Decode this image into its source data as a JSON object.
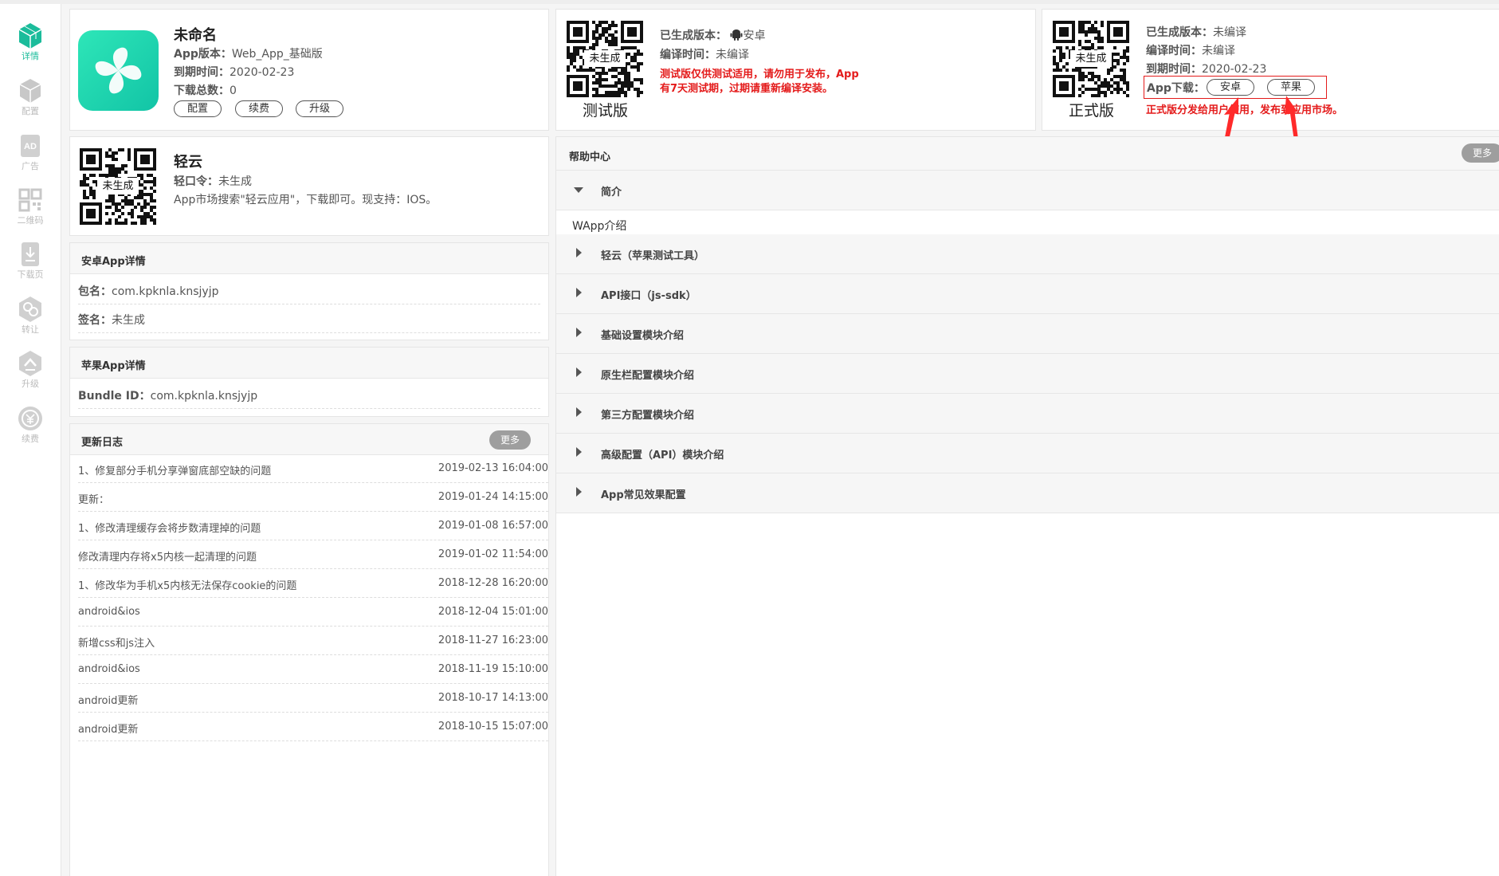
{
  "sidebar": {
    "items": [
      {
        "label": "详情",
        "icon": "cube-icon"
      },
      {
        "label": "配置",
        "icon": "box-icon"
      },
      {
        "label": "广告",
        "icon": "ad-icon"
      },
      {
        "label": "二维码",
        "icon": "qrcode-icon"
      },
      {
        "label": "下载页",
        "icon": "download-page-icon"
      },
      {
        "label": "转让",
        "icon": "transfer-icon"
      },
      {
        "label": "升级",
        "icon": "upgrade-icon"
      },
      {
        "label": "续费",
        "icon": "renew-icon"
      }
    ]
  },
  "app_card": {
    "name": "未命名",
    "version_label": "App版本：",
    "version_value": "Web_App_基础版",
    "expire_label": "到期时间：",
    "expire_value": "2020-02-23",
    "downloads_label": "下载总数：",
    "downloads_value": "0",
    "buttons": [
      "配置",
      "续费",
      "升级"
    ]
  },
  "test_build": {
    "qr_badge": "未生成",
    "caption": "测试版",
    "version_label": "已生成版本：",
    "version_value": "安卓",
    "compile_label": "编译时间：",
    "compile_value": "未编译",
    "warning_line1": "测试版仅供测试适用，请勿用于发布，App",
    "warning_line2": "有7天测试期，过期请重新编译安装。"
  },
  "release_build": {
    "qr_badge": "未生成",
    "caption": "正式版",
    "version_label": "已生成版本：",
    "version_value": "未编译",
    "compile_label": "编译时间：",
    "compile_value": "未编译",
    "expire_label": "到期时间：",
    "expire_value": "2020-02-23",
    "download_label": "App下载：",
    "download_buttons": [
      "安卓",
      "苹果"
    ],
    "note": "正式版分发给用户使用，发布到应用市场。"
  },
  "qingyun": {
    "qr_badge": "未生成",
    "title": "轻云",
    "code_label": "轻口令：",
    "code_value": "未生成",
    "desc": "App市场搜索\"轻云应用\"，下载即可。现支持：IOS。"
  },
  "android_details": {
    "title": "安卓App详情",
    "package_label": "包名：",
    "package_value": "com.kpknla.knsjyjp",
    "sign_label": "签名：",
    "sign_value": "未生成"
  },
  "ios_details": {
    "title": "苹果App详情",
    "bundle_label": "Bundle ID：",
    "bundle_value": "com.kpknla.knsjyjp"
  },
  "changelog": {
    "title": "更新日志",
    "more": "更多",
    "entries": [
      {
        "text": "1、修复部分手机分享弹窗底部空缺的问题",
        "time": "2019-02-13 16:04:00"
      },
      {
        "text": "更新：",
        "time": "2019-01-24 14:15:00"
      },
      {
        "text": "1、修改清理缓存会将步数清理掉的问题",
        "time": "2019-01-08 16:57:00"
      },
      {
        "text": "修改清理内存将x5内核一起清理的问题",
        "time": "2019-01-02 11:54:00"
      },
      {
        "text": "1、修改华为手机x5内核无法保存cookie的问题",
        "time": "2018-12-28 16:20:00"
      },
      {
        "text": "android&ios",
        "time": "2018-12-04 15:01:00"
      },
      {
        "text": "新增css和js注入",
        "time": "2018-11-27 16:23:00"
      },
      {
        "text": "android&ios",
        "time": "2018-11-19 15:10:00"
      },
      {
        "text": "android更新",
        "time": "2018-10-17 14:13:00"
      },
      {
        "text": "android更新",
        "time": "2018-10-15 15:07:00"
      }
    ]
  },
  "help_center": {
    "title": "帮助中心",
    "more": "更多",
    "expanded": {
      "label": "简介",
      "content": "WApp介绍"
    },
    "items": [
      "轻云（苹果测试工具）",
      "API接口（js-sdk）",
      "基础设置模块介绍",
      "原生栏配置模块介绍",
      "第三方配置模块介绍",
      "高级配置（API）模块介绍",
      "App常见效果配置"
    ]
  },
  "colors": {
    "accent": "#1bbc9b",
    "warning": "#e41b1b"
  }
}
